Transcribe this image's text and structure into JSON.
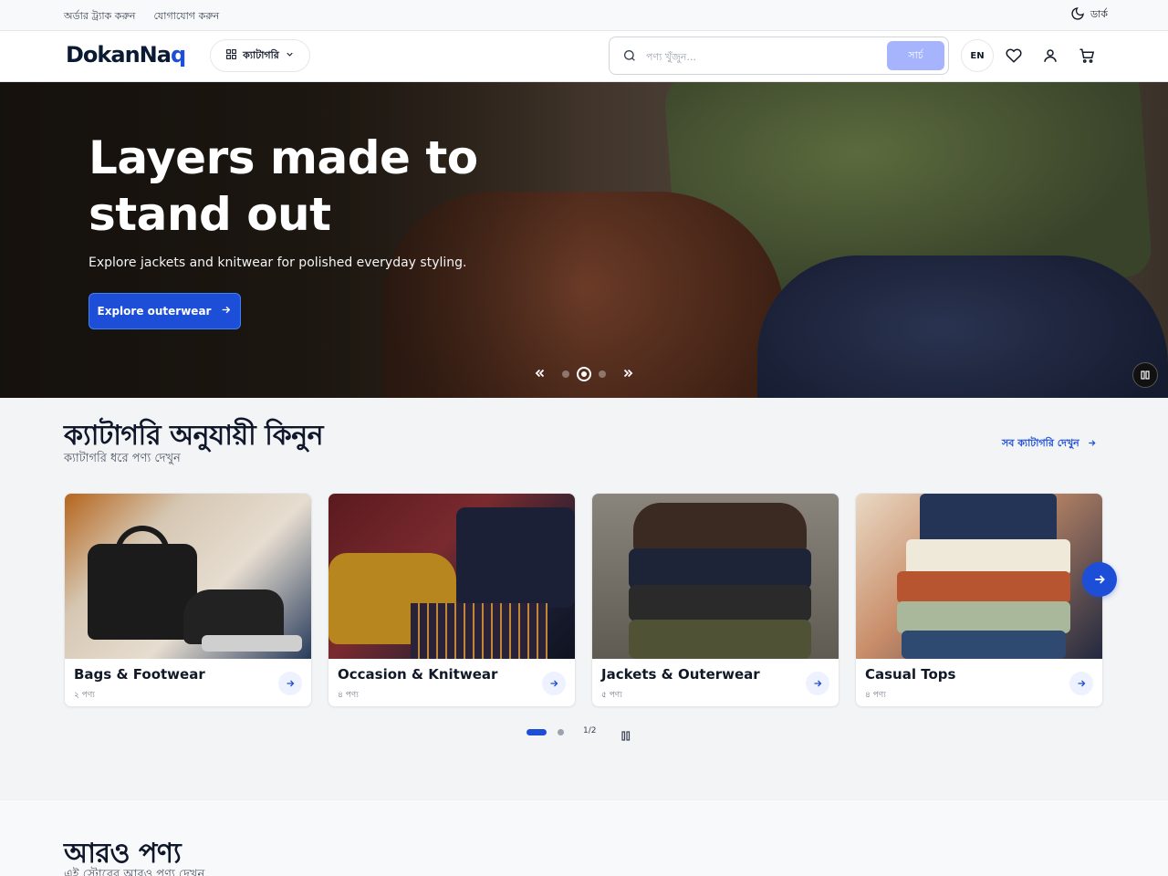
{
  "topbar": {
    "links": [
      "অর্ডার ট্র্যাক করুন",
      "যোগাযোগ করুন"
    ],
    "theme_label": "ডার্ক"
  },
  "header": {
    "logo_main": "DokanNa",
    "logo_accent": "q",
    "categories_label": "ক্যাটাগরি",
    "search_placeholder": "পণ্য খুঁজুন...",
    "search_button": "সার্চ",
    "language": "EN"
  },
  "hero": {
    "title": "Layers made to stand out",
    "subtitle": "Explore jackets and knitwear for polished everyday styling.",
    "cta": "Explore outerwear",
    "active_slide": 1
  },
  "categories": {
    "title": "ক্যাটাগরি অনুযায়ী কিনুন",
    "subtitle": "ক্যাটাগরি ধরে পণ্য দেখুন",
    "view_all": "সব ক্যাটাগরি দেখুন",
    "items": [
      {
        "name": "Bags & Footwear",
        "count": "২ পণ্য"
      },
      {
        "name": "Occasion & Knitwear",
        "count": "৪ পণ্য"
      },
      {
        "name": "Jackets & Outerwear",
        "count": "৫ পণ্য"
      },
      {
        "name": "Casual Tops",
        "count": "৪ পণ্য"
      }
    ],
    "page_indicator": "1/2"
  },
  "more_products": {
    "title": "আরও পণ্য",
    "subtitle": "এই স্টোরের আরও পণ্য দেখুন"
  },
  "colors": {
    "accent": "#1d4ed8",
    "search_button": "#a5b4fc"
  }
}
